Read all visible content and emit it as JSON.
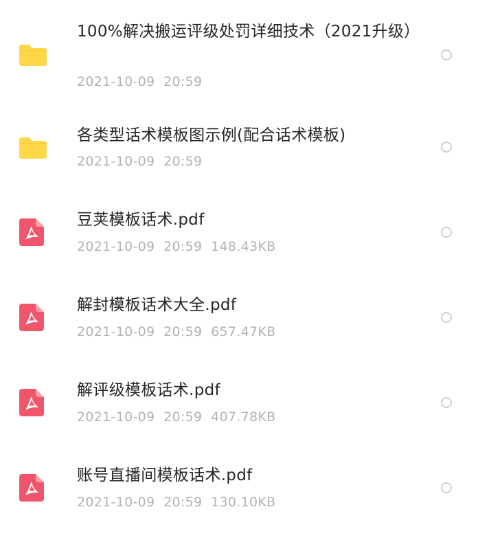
{
  "colors": {
    "folder": "#FFD84A",
    "pdf": "#F0556B",
    "name_text": "#262626",
    "meta_text": "#B2B2B2",
    "select_border": "#CFCFCF"
  },
  "files": [
    {
      "icon": "folder-icon",
      "name": "100%解决搬运评级处罚详细技术（2021升级）",
      "date": "2021-10-09",
      "time": "20:59",
      "size": ""
    },
    {
      "icon": "folder-icon",
      "name": "各类型话术模板图示例(配合话术模板)",
      "date": "2021-10-09",
      "time": "20:59",
      "size": ""
    },
    {
      "icon": "pdf-file-icon",
      "name": "豆荚模板话术.pdf",
      "date": "2021-10-09",
      "time": "20:59",
      "size": "148.43KB"
    },
    {
      "icon": "pdf-file-icon",
      "name": "解封模板话术大全.pdf",
      "date": "2021-10-09",
      "time": "20:59",
      "size": "657.47KB"
    },
    {
      "icon": "pdf-file-icon",
      "name": "解评级模板话术.pdf",
      "date": "2021-10-09",
      "time": "20:59",
      "size": "407.78KB"
    },
    {
      "icon": "pdf-file-icon",
      "name": "账号直播间模板话术.pdf",
      "date": "2021-10-09",
      "time": "20:59",
      "size": "130.10KB"
    }
  ]
}
